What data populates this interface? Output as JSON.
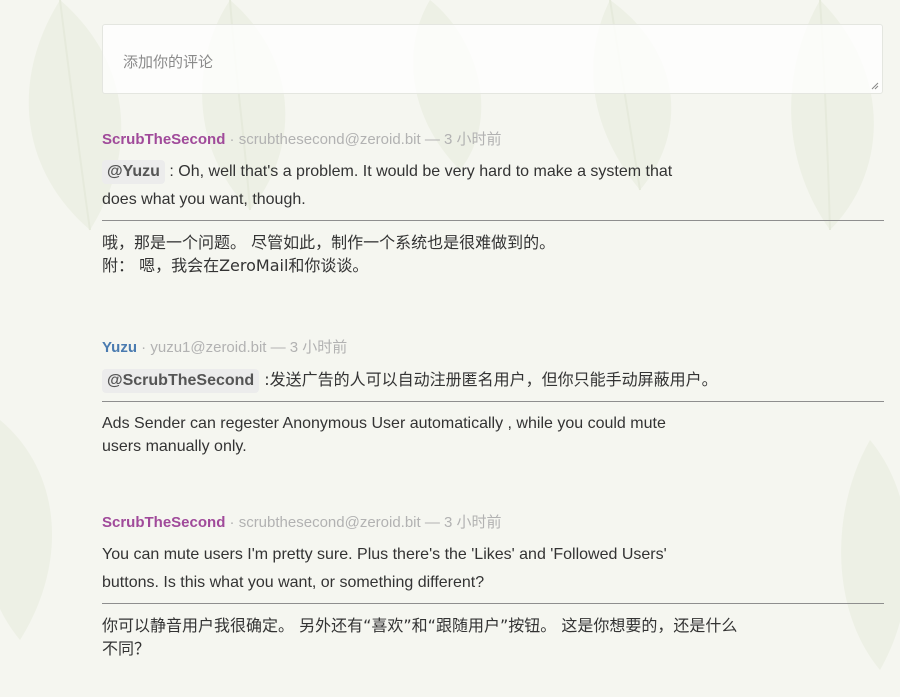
{
  "comment_box": {
    "placeholder": "添加你的评论"
  },
  "comments": [
    {
      "author": "ScrubTheSecond",
      "meta": " · scrubthesecond@zeroid.bit — 3 小时前",
      "mention": "@Yuzu",
      "text_line1": " : Oh, well that's a problem. It would be very hard to make a system that",
      "text_line2": "does what you want, though.",
      "reply_line1": "哦，那是一个问题。 尽管如此，制作一个系统也是很难做到的。",
      "reply_line2": "附： 嗯，我会在ZeroMail和你谈谈。"
    },
    {
      "author": "Yuzu",
      "meta": " · yuzu1@zeroid.bit — 3 小时前",
      "mention": "@ScrubTheSecond",
      "text_line1": " :发送广告的人可以自动注册匿名用户，但你只能手动屏蔽用户。",
      "reply_line1": "Ads Sender can regester Anonymous User automatically , while you could mute",
      "reply_line2": "users manually only."
    },
    {
      "author": "ScrubTheSecond",
      "meta": " · scrubthesecond@zeroid.bit — 3 小时前",
      "text_line1": "You can mute users I'm pretty sure. Plus there's the 'Likes' and 'Followed Users'",
      "text_line2": "buttons. Is this what you want, or something different?",
      "reply_line1": "你可以静音用户我很确定。 另外还有“喜欢”和“跟随用户”按钮。 这是你想要的，还是什么",
      "reply_line2": "不同？"
    }
  ],
  "colors": {
    "author_purple": "#a04a9a",
    "author_blue": "#4a7bb0",
    "background": "#f5f6f0"
  }
}
